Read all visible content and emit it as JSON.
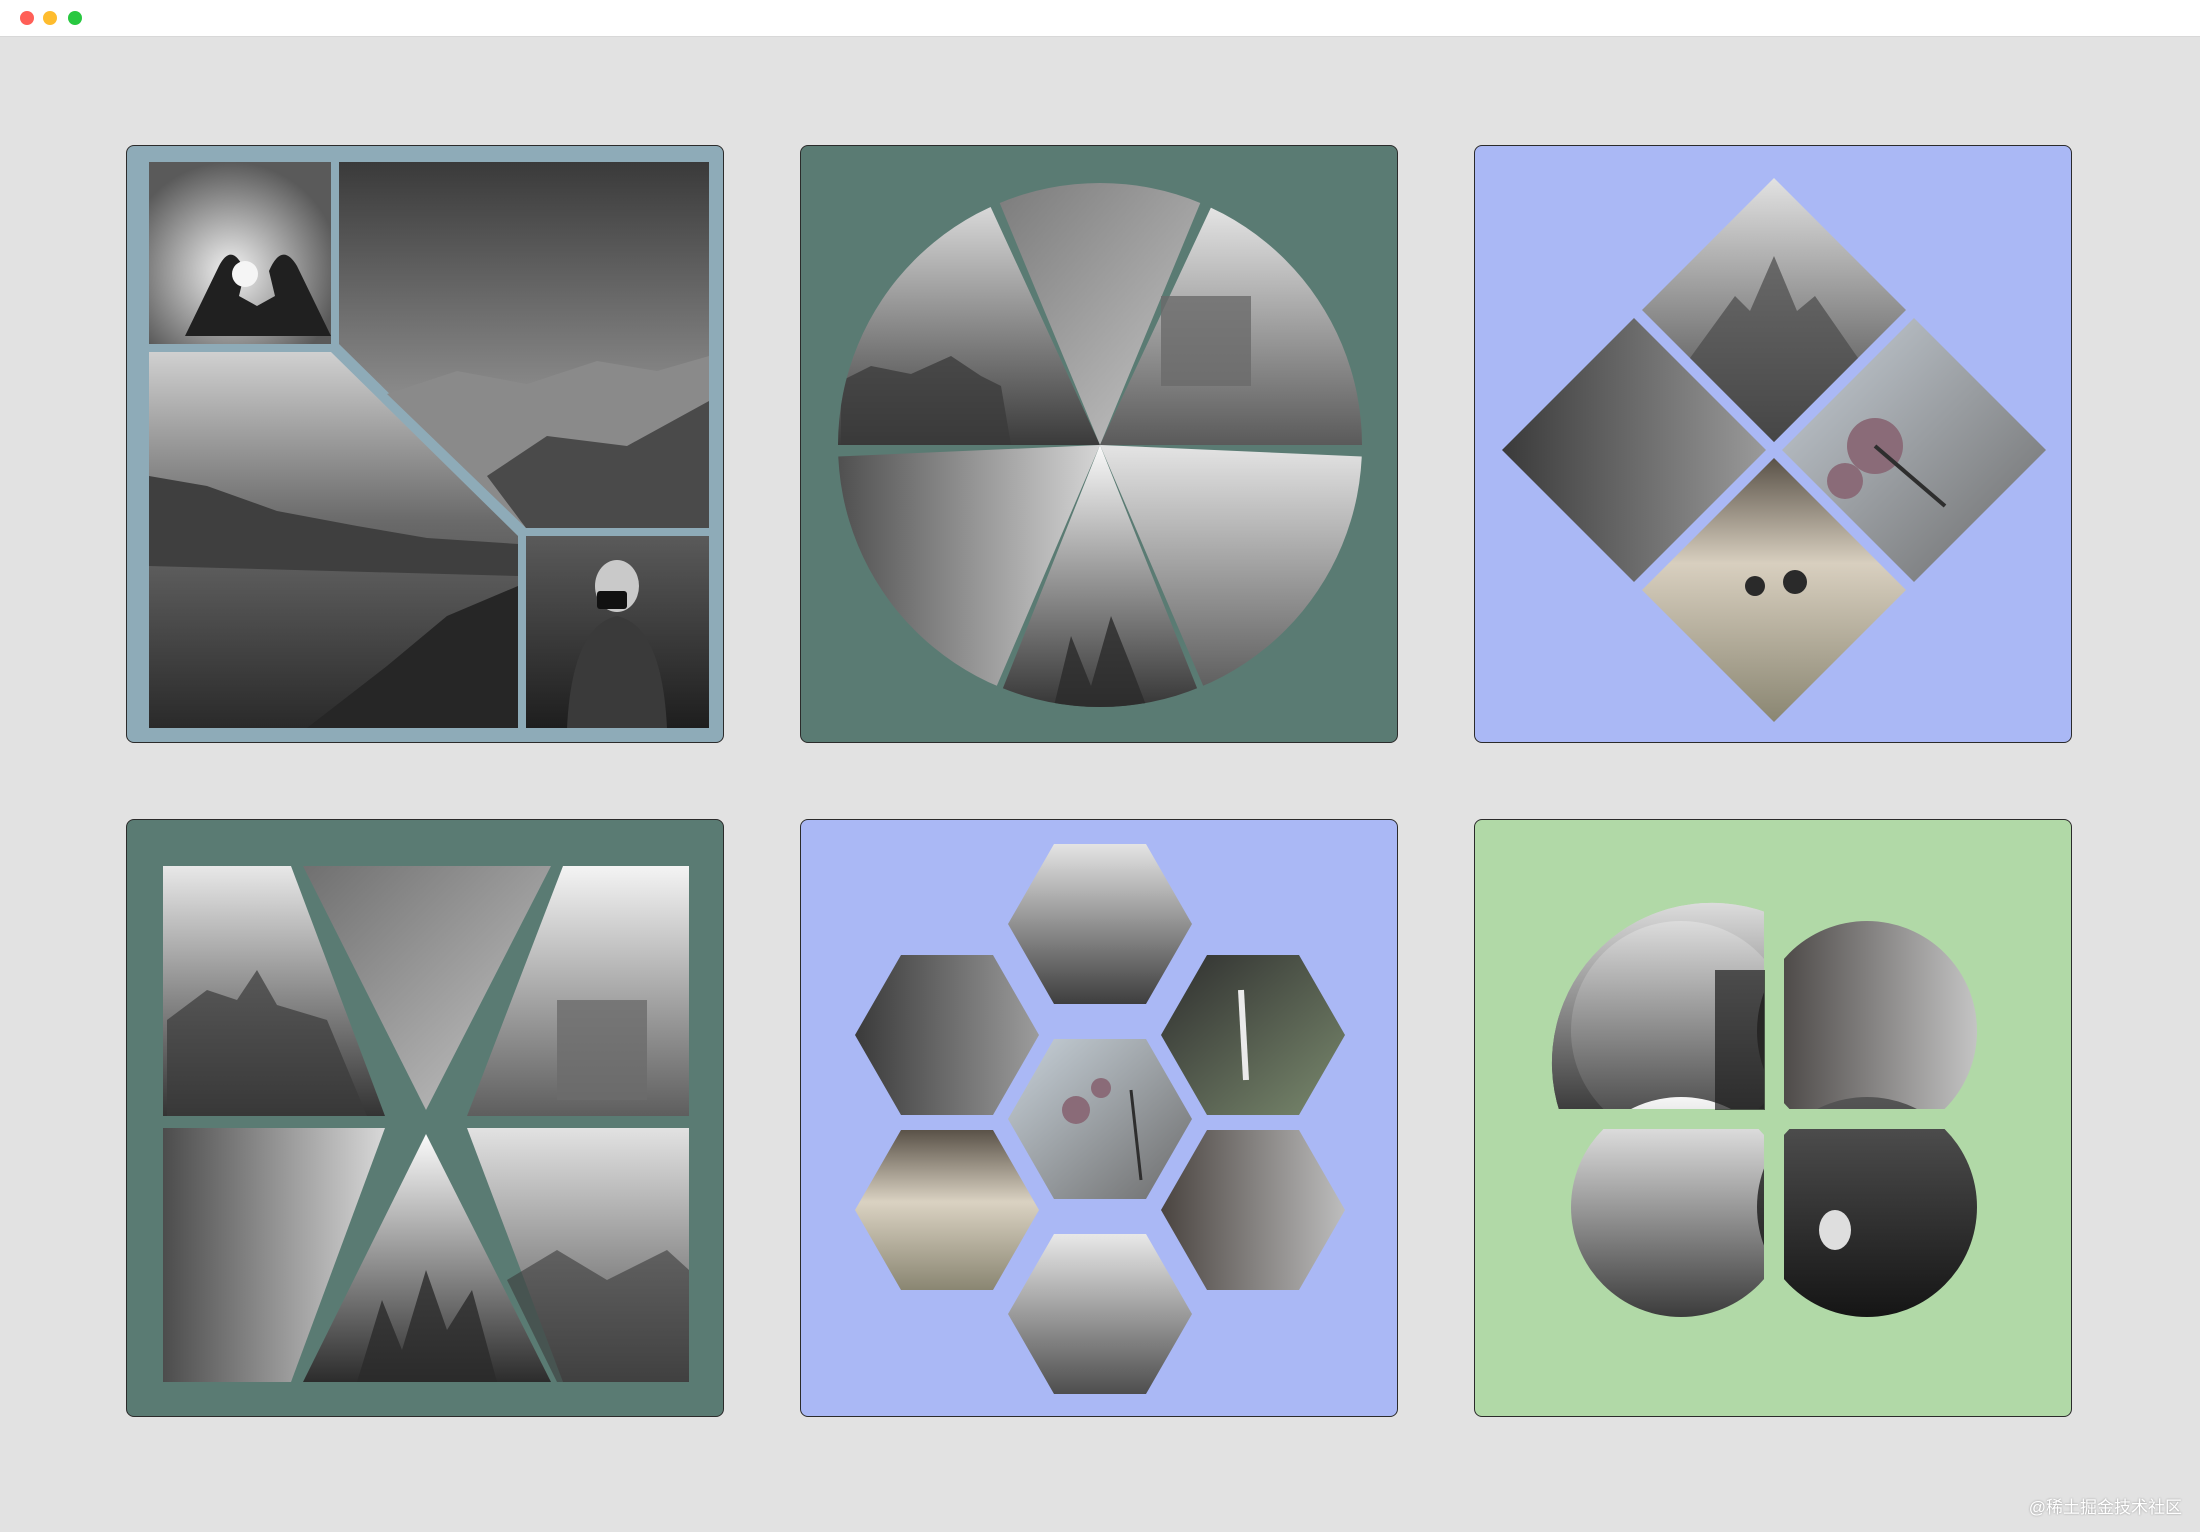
{
  "window": {
    "traffic_lights": {
      "close": "#ff5f57",
      "minimize": "#febc2e",
      "maximize": "#28c840"
    },
    "background": "#e2e2e2"
  },
  "cards": [
    {
      "id": "card-square-split",
      "layout": "square-split",
      "background": "#8eabb8",
      "tiles": [
        "heart-hands-sunset",
        "mountain-valley",
        "rocky-coastline",
        "woman-with-camera"
      ]
    },
    {
      "id": "card-circle-pie",
      "layout": "circle-pie",
      "background": "#5a7b73",
      "tiles": [
        "castle-on-hill",
        "old-building-facade",
        "concrete-bunker",
        "narrow-alley",
        "city-skyline",
        "rooftops"
      ]
    },
    {
      "id": "card-diamond-grid",
      "layout": "diamond-grid",
      "background": "#aab8f5",
      "tiles": [
        "castle-on-hill",
        "rock-cliffs",
        "pink-flowers",
        "field-with-trees"
      ]
    },
    {
      "id": "card-square-pie",
      "layout": "square-pie",
      "background": "#5a7b73",
      "tiles": [
        "castle-on-hill",
        "old-building-facade",
        "concrete-bunker",
        "narrow-alley",
        "city-skyline",
        "rooftops"
      ]
    },
    {
      "id": "card-hexagon-cluster",
      "layout": "hexagon-cluster",
      "background": "#aab8f5",
      "tiles": [
        "castle-on-hill",
        "rock-cliffs",
        "waterfall",
        "pink-flowers",
        "field-with-trees",
        "brick-alley",
        "coastal-cliffs"
      ]
    },
    {
      "id": "card-clover-circles",
      "layout": "clover-circles",
      "background": "#b1d9a7",
      "tiles": [
        "park-and-skyscrapers",
        "brick-street",
        "city-skyline",
        "cathedral-dome-night"
      ]
    }
  ],
  "watermark": "@稀土掘金技术社区"
}
